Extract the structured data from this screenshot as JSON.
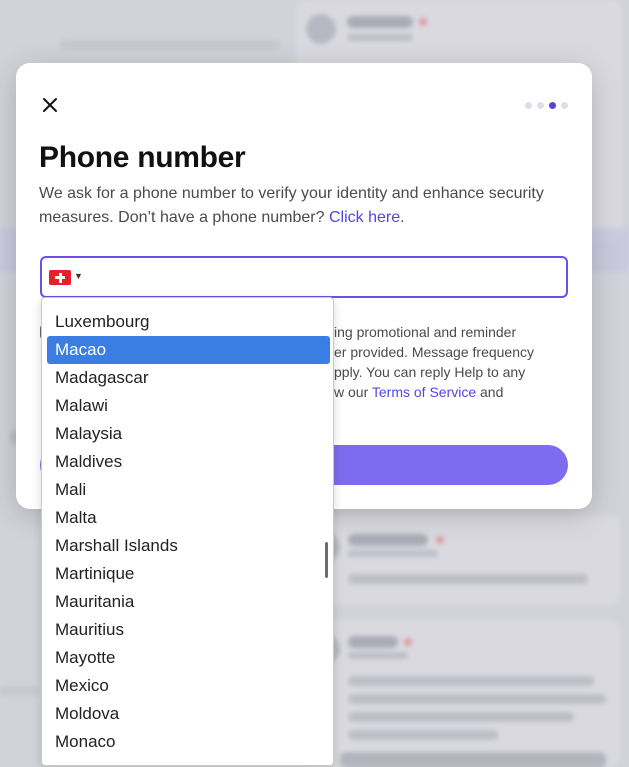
{
  "modal": {
    "title": "Phone number",
    "description": "We ask for a phone number to verify your identity and enhance security measures. Don’t have a phone number?",
    "click_here_link": "Click here",
    "description_end": ".",
    "steps_total": 4,
    "steps_active": 3,
    "phone_input": {
      "value": "",
      "placeholder": ""
    },
    "selected_flag": "switzerland-flag",
    "consent": {
      "text": "…ing promotional and reminder …er provided. Message frequency …pply. You can reply Help to any …w our",
      "terms_link": "Terms of Service",
      "text_end": "and"
    },
    "continue_button_label": ""
  },
  "country_dropdown": {
    "options": [
      "Luxembourg",
      "Macao",
      "Madagascar",
      "Malawi",
      "Malaysia",
      "Maldives",
      "Mali",
      "Malta",
      "Marshall Islands",
      "Martinique",
      "Mauritania",
      "Mauritius",
      "Mayotte",
      "Mexico",
      "Moldova",
      "Monaco"
    ],
    "selected": "Macao"
  },
  "colors": {
    "accent": "#6d4fe8",
    "link": "#4f46e5",
    "selected_option": "#3a7ee4",
    "button": "#7d6cf0"
  }
}
